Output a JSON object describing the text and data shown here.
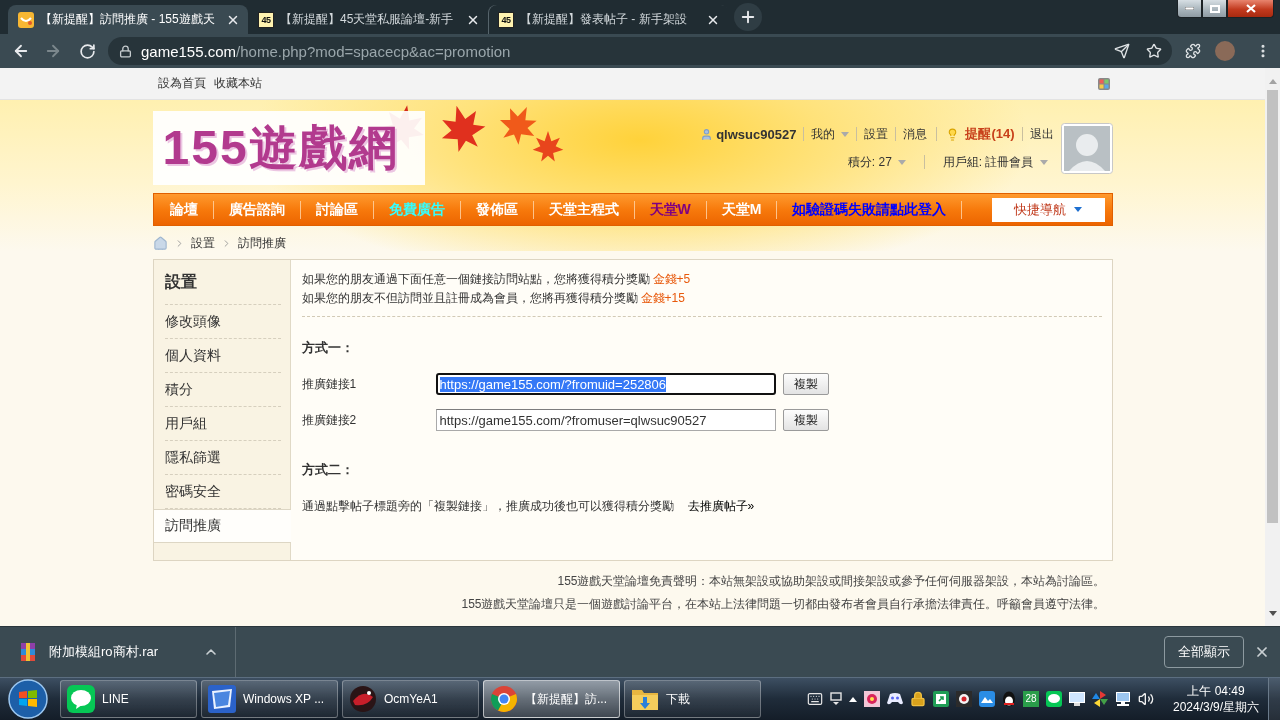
{
  "browser": {
    "tabs": [
      {
        "title": "【新提醒】訪問推廣 - 155遊戲天",
        "selected": true
      },
      {
        "title": "【新提醒】45天堂私服論壇-新手",
        "favicon_label": "45",
        "selected": false
      },
      {
        "title": "【新提醒】發表帖子 - 新手架設",
        "favicon_label": "45",
        "selected": false
      }
    ],
    "forward_disabled": true,
    "url_host": "game155.com",
    "url_path": "/home.php?mod=spacecp&ac=promotion"
  },
  "top_links": [
    "設為首頁",
    "收藏本站"
  ],
  "header": {
    "logo": "155遊戲網",
    "username": "qlwsuc90527",
    "user_links": [
      {
        "label": "我的",
        "kind": "menu"
      },
      {
        "label": "設置",
        "kind": "plain"
      },
      {
        "label": "消息",
        "kind": "plain"
      },
      {
        "label": "提醒(14)",
        "kind": "alert"
      },
      {
        "label": "退出",
        "kind": "plain"
      }
    ],
    "stats": [
      {
        "label": "積分: 27",
        "kind": "menu"
      },
      {
        "label": "用戶組: 註冊會員",
        "kind": "menu"
      }
    ]
  },
  "nav": {
    "items": [
      {
        "label": "論壇",
        "color": "#ffffff"
      },
      {
        "label": "廣告諮詢",
        "color": "#ffffff"
      },
      {
        "label": "討論區",
        "color": "#ffffff"
      },
      {
        "label": "免費廣告",
        "color": "#33ffff"
      },
      {
        "label": "發佈區",
        "color": "#ffffff"
      },
      {
        "label": "天堂主程式",
        "color": "#ffffff"
      },
      {
        "label": "天堂W",
        "color": "#800080"
      },
      {
        "label": "天堂M",
        "color": "#ffffff"
      },
      {
        "label": "如驗證碼失敗請點此登入",
        "color": "#0000ff"
      }
    ],
    "quick_nav": "快捷導航"
  },
  "breadcrumb": [
    "設置",
    "訪問推廣"
  ],
  "sidebar": {
    "title": "設置",
    "items": [
      {
        "label": "修改頭像",
        "selected": false
      },
      {
        "label": "個人資料",
        "selected": false
      },
      {
        "label": "積分",
        "selected": false
      },
      {
        "label": "用戶組",
        "selected": false
      },
      {
        "label": "隱私篩選",
        "selected": false
      },
      {
        "label": "密碼安全",
        "selected": false
      },
      {
        "label": "訪問推廣",
        "selected": true
      }
    ]
  },
  "promotion": {
    "intro": [
      {
        "text": "如果您的朋友通過下面任意一個鏈接訪問站點，您將獲得積分獎勵",
        "reward": "金錢+5"
      },
      {
        "text": "如果您的朋友不但訪問並且註冊成為會員，您將再獲得積分獎勵",
        "reward": "金錢+15"
      }
    ],
    "method_one": {
      "heading": "方式一：",
      "links": [
        {
          "label": "推廣鏈接1",
          "value": "https://game155.com/?fromuid=252806",
          "selected": true,
          "button": "複製"
        },
        {
          "label": "推廣鏈接2",
          "value": "https://game155.com/?fromuser=qlwsuc90527",
          "selected": false,
          "button": "複製"
        }
      ]
    },
    "method_two": {
      "heading": "方式二：",
      "text": "通過點擊帖子標題旁的「複製鏈接」，推廣成功後也可以獲得積分獎勵",
      "link": "去推廣帖子»"
    }
  },
  "footer": [
    "155遊戲天堂論壇免責聲明：本站無架設或協助架設或間接架設或參予任何伺服器架設，本站為討論區。",
    "155遊戲天堂論壇只是一個遊戲討論平台，在本站上法律問題一切都由發布者會員自行承擔法律責任。呼籲會員遵守法律。"
  ],
  "downloads": {
    "file": "附加模組ro商村.rar",
    "show_all": "全部顯示"
  },
  "taskbar": {
    "items": [
      {
        "label": "LINE",
        "kind": "line",
        "selected": false
      },
      {
        "label": "Windows XP ...",
        "kind": "xp",
        "selected": false
      },
      {
        "label": "OcmYeA1",
        "kind": "game",
        "selected": false
      },
      {
        "label": "【新提醒】訪...",
        "kind": "browser",
        "selected": true
      },
      {
        "label": "下載",
        "kind": "folder",
        "selected": false
      }
    ],
    "tray_badge": "28",
    "time": "上午 04:49",
    "date": "2024/3/9/星期六"
  }
}
